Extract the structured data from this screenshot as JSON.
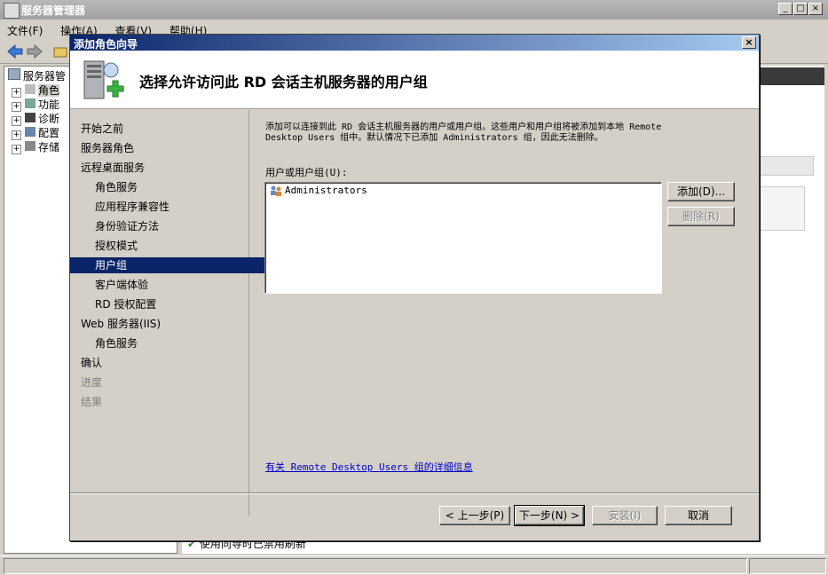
{
  "main_window": {
    "title": "服务器管理器",
    "menu": [
      "文件(F)",
      "操作(A)",
      "查看(V)",
      "帮助(H)"
    ],
    "tree": [
      "服务器管",
      "角色",
      "功能",
      "诊断",
      "配置",
      "存储"
    ],
    "status_text": "使用向导时已禁用刷新"
  },
  "dialog": {
    "title": "添加角色向导",
    "heading": "选择允许访问此 RD 会话主机服务器的用户组",
    "nav": [
      {
        "label": "开始之前",
        "indent": false,
        "state": "normal"
      },
      {
        "label": "服务器角色",
        "indent": false,
        "state": "normal"
      },
      {
        "label": "远程桌面服务",
        "indent": false,
        "state": "normal"
      },
      {
        "label": "角色服务",
        "indent": true,
        "state": "normal"
      },
      {
        "label": "应用程序兼容性",
        "indent": true,
        "state": "normal"
      },
      {
        "label": "身份验证方法",
        "indent": true,
        "state": "normal"
      },
      {
        "label": "授权模式",
        "indent": true,
        "state": "normal"
      },
      {
        "label": "用户组",
        "indent": true,
        "state": "selected"
      },
      {
        "label": "客户端体验",
        "indent": true,
        "state": "normal"
      },
      {
        "label": "RD 授权配置",
        "indent": true,
        "state": "normal"
      },
      {
        "label": "Web 服务器(IIS)",
        "indent": false,
        "state": "normal"
      },
      {
        "label": "角色服务",
        "indent": true,
        "state": "normal"
      },
      {
        "label": "确认",
        "indent": false,
        "state": "normal"
      },
      {
        "label": "进度",
        "indent": false,
        "state": "disabled"
      },
      {
        "label": "结果",
        "indent": false,
        "state": "disabled"
      }
    ],
    "description_line1": "添加可以连接到此 RD 会话主机服务器的用户或用户组。这些用户和用户组将被添加到本地 Remote",
    "description_line2": "Desktop Users 组中。默认情况下已添加 Administrators 组，因此无法删除。",
    "list_label": "用户或用户组(U):",
    "list_items": [
      "Administrators"
    ],
    "add_button": "添加(D)...",
    "remove_button": "删除(R)",
    "info_link": "有关 Remote Desktop Users 组的详细信息",
    "back_button": "< 上一步(P)",
    "next_button": "下一步(N) >",
    "install_button": "安装(I)",
    "cancel_button": "取消"
  }
}
